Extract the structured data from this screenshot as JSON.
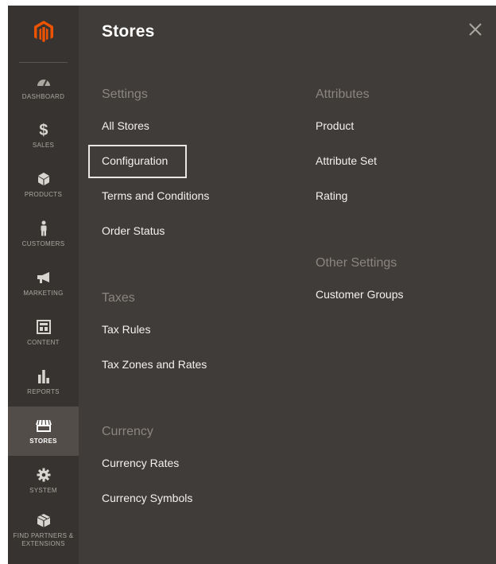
{
  "sidebar": {
    "logo_icon": "magento-logo-icon",
    "brand_color": "#eb5202",
    "items": [
      {
        "label": "DASHBOARD",
        "icon": "dashboard-icon",
        "active": false
      },
      {
        "label": "SALES",
        "icon": "dollar-icon",
        "active": false
      },
      {
        "label": "PRODUCTS",
        "icon": "cube-icon",
        "active": false
      },
      {
        "label": "CUSTOMERS",
        "icon": "person-icon",
        "active": false
      },
      {
        "label": "MARKETING",
        "icon": "megaphone-icon",
        "active": false
      },
      {
        "label": "CONTENT",
        "icon": "layout-icon",
        "active": false
      },
      {
        "label": "REPORTS",
        "icon": "bar-chart-icon",
        "active": false
      },
      {
        "label": "STORES",
        "icon": "storefront-icon",
        "active": true
      },
      {
        "label": "SYSTEM",
        "icon": "gear-icon",
        "active": false
      },
      {
        "label": "FIND PARTNERS & EXTENSIONS",
        "icon": "box-icon",
        "active": false
      }
    ]
  },
  "panel": {
    "title": "Stores",
    "close_icon": "close-icon",
    "left_sections": [
      {
        "title": "Settings",
        "links": [
          "All Stores",
          "Configuration",
          "Terms and Conditions",
          "Order Status"
        ]
      },
      {
        "title": "Taxes",
        "links": [
          "Tax Rules",
          "Tax Zones and Rates"
        ]
      },
      {
        "title": "Currency",
        "links": [
          "Currency Rates",
          "Currency Symbols"
        ]
      }
    ],
    "right_sections": [
      {
        "title": "Attributes",
        "links": [
          "Product",
          "Attribute Set",
          "Rating"
        ]
      },
      {
        "title": "Other Settings",
        "links": [
          "Customer Groups"
        ]
      }
    ],
    "highlighted_link": "Configuration"
  }
}
